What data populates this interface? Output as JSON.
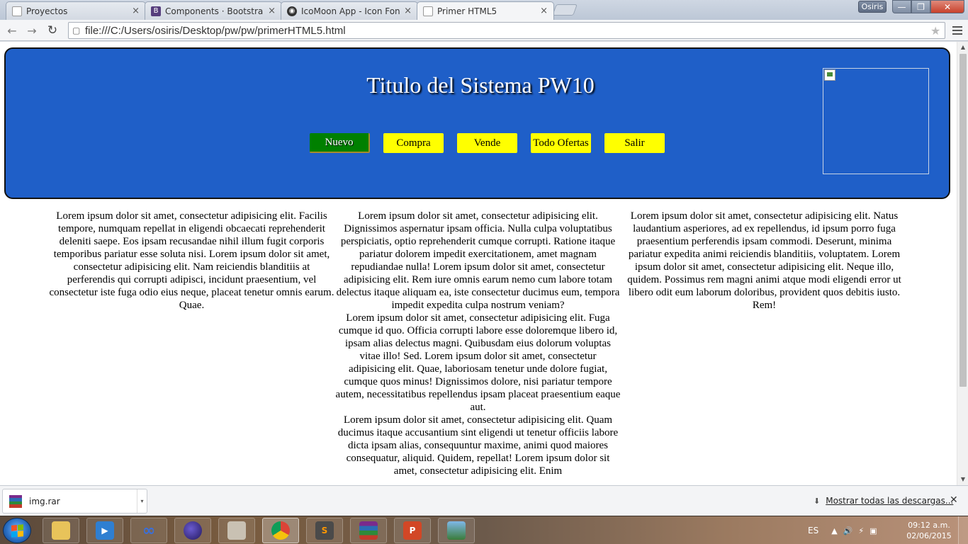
{
  "browser": {
    "tabs": [
      {
        "title": "Proyectos",
        "favicon": "page-icon",
        "active": false
      },
      {
        "title": "Components · Bootstrap",
        "favicon": "bootstrap-icon",
        "active": false
      },
      {
        "title": "IcoMoon App - Icon Font,",
        "favicon": "icomoon-icon",
        "active": false
      },
      {
        "title": "Primer HTML5",
        "favicon": "page-icon",
        "active": true
      }
    ],
    "tab_close": "×",
    "user_name": "Osiris",
    "window_buttons": {
      "minimize": "—",
      "maximize": "❐",
      "close": "✕"
    },
    "nav": {
      "back": "←",
      "forward": "→",
      "reload": "↻"
    },
    "url": "file:///C:/Users/osiris/Desktop/pw/pw/primerHTML5.html",
    "bookmark_star": "★"
  },
  "page": {
    "header_color": "#1f5fc8",
    "title": "Titulo del Sistema PW10",
    "menu": [
      {
        "label": "Nuevo",
        "active": true
      },
      {
        "label": "Compra",
        "active": false
      },
      {
        "label": "Vende",
        "active": false
      },
      {
        "label": "Todo Ofertas",
        "active": false
      },
      {
        "label": "Salir",
        "active": false
      }
    ],
    "columns": [
      {
        "paragraphs": [
          "Lorem ipsum dolor sit amet, consectetur adipisicing elit. Facilis tempore, numquam repellat in eligendi obcaecati reprehenderit deleniti saepe. Eos ipsam recusandae nihil illum fugit corporis temporibus pariatur esse soluta nisi. Lorem ipsum dolor sit amet, consectetur adipisicing elit. Nam reiciendis blanditiis at perferendis qui corrupti adipisci, incidunt praesentium, vel consectetur iste fuga odio eius neque, placeat tenetur omnis earum. Quae."
        ]
      },
      {
        "paragraphs": [
          "Lorem ipsum dolor sit amet, consectetur adipisicing elit. Dignissimos aspernatur ipsam officia. Nulla culpa voluptatibus perspiciatis, optio reprehenderit cumque corrupti. Ratione itaque pariatur dolorem impedit exercitationem, amet magnam repudiandae nulla! Lorem ipsum dolor sit amet, consectetur adipisicing elit. Rem iure omnis earum nemo cum labore totam delectus itaque aliquam ea, iste consectetur ducimus eum, tempora impedit expedita culpa nostrum veniam?",
          "Lorem ipsum dolor sit amet, consectetur adipisicing elit. Fuga cumque id quo. Officia corrupti labore esse doloremque libero id, ipsam alias delectus magni. Quibusdam eius dolorum voluptas vitae illo! Sed. Lorem ipsum dolor sit amet, consectetur adipisicing elit. Quae, laboriosam tenetur unde dolore fugiat, cumque quos minus! Dignissimos dolore, nisi pariatur tempore autem, necessitatibus repellendus ipsam placeat praesentium eaque aut.",
          "Lorem ipsum dolor sit amet, consectetur adipisicing elit. Quam ducimus itaque accusantium sint eligendi ut tenetur officiis labore dicta ipsam alias, consequuntur maxime, animi quod maiores consequatur, aliquid. Quidem, repellat! Lorem ipsum dolor sit amet, consectetur adipisicing elit. Enim"
        ]
      },
      {
        "paragraphs": [
          "Lorem ipsum dolor sit amet, consectetur adipisicing elit. Natus laudantium asperiores, ad ex repellendus, id ipsum porro fuga praesentium perferendis ipsam commodi. Deserunt, minima pariatur expedita animi reiciendis blanditiis, voluptatem. Lorem ipsum dolor sit amet, consectetur adipisicing elit. Neque illo, quidem. Possimus rem magni animi atque modi eligendi error ut libero odit eum laborum doloribus, provident quos debitis iusto. Rem!"
        ]
      }
    ]
  },
  "download_shelf": {
    "item_name": "img.rar",
    "item_menu_arrow": "▾",
    "show_all": "Mostrar todas las descargas...",
    "close": "✕"
  },
  "taskbar": {
    "apps": [
      {
        "name": "explorer",
        "icon": "folder-icon",
        "active": false
      },
      {
        "name": "media",
        "icon": "media-player-icon",
        "active": false
      },
      {
        "name": "infinity",
        "icon": "infinity-icon",
        "active": false
      },
      {
        "name": "eclipse",
        "icon": "eclipse-icon",
        "active": false
      },
      {
        "name": "tools",
        "icon": "tools-icon",
        "active": false
      },
      {
        "name": "chrome",
        "icon": "chrome-icon",
        "active": true
      },
      {
        "name": "sublime",
        "icon": "sublime-text-icon",
        "active": false
      },
      {
        "name": "winrar",
        "icon": "winrar-icon",
        "active": false
      },
      {
        "name": "powerpoint",
        "icon": "powerpoint-icon",
        "active": false
      },
      {
        "name": "photos",
        "icon": "photo-viewer-icon",
        "active": false
      }
    ],
    "app_glyphs": [
      "",
      "▶",
      "∞",
      "",
      "",
      "",
      "S",
      "",
      "P",
      ""
    ],
    "language": "ES",
    "tray_icons": [
      "▲",
      "🔊",
      "⚡",
      "▣"
    ],
    "time": "09:12 a.m.",
    "date": "02/06/2015"
  }
}
